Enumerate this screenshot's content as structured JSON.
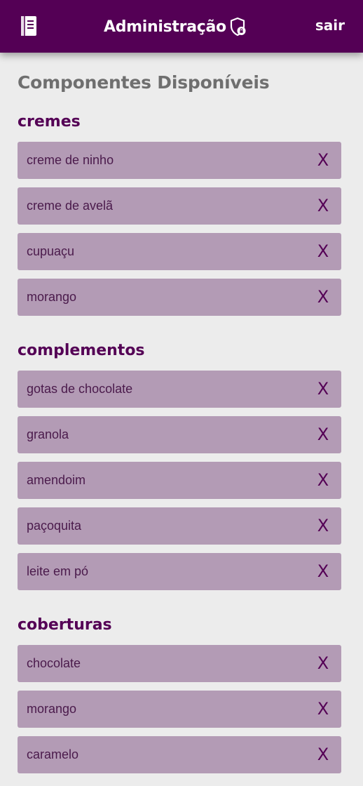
{
  "header": {
    "title": "Administração",
    "logout_label": "sair",
    "left_icon": "book-icon",
    "title_icon": "shield-lock-icon"
  },
  "page_title": "Componentes Disponíveis",
  "colors": {
    "header_bg": "#540055",
    "item_bg": "#b39bb5",
    "section_title": "#540055",
    "page_bg": "#ececec"
  },
  "remove_label": "X",
  "sections": [
    {
      "title": "cremes",
      "items": [
        "creme de ninho",
        "creme de avelã",
        "cupuaçu",
        "morango"
      ]
    },
    {
      "title": "complementos",
      "items": [
        "gotas de chocolate",
        "granola",
        "amendoim",
        "paçoquita",
        "leite em pó"
      ]
    },
    {
      "title": "coberturas",
      "items": [
        "chocolate",
        "morango",
        "caramelo"
      ]
    }
  ]
}
